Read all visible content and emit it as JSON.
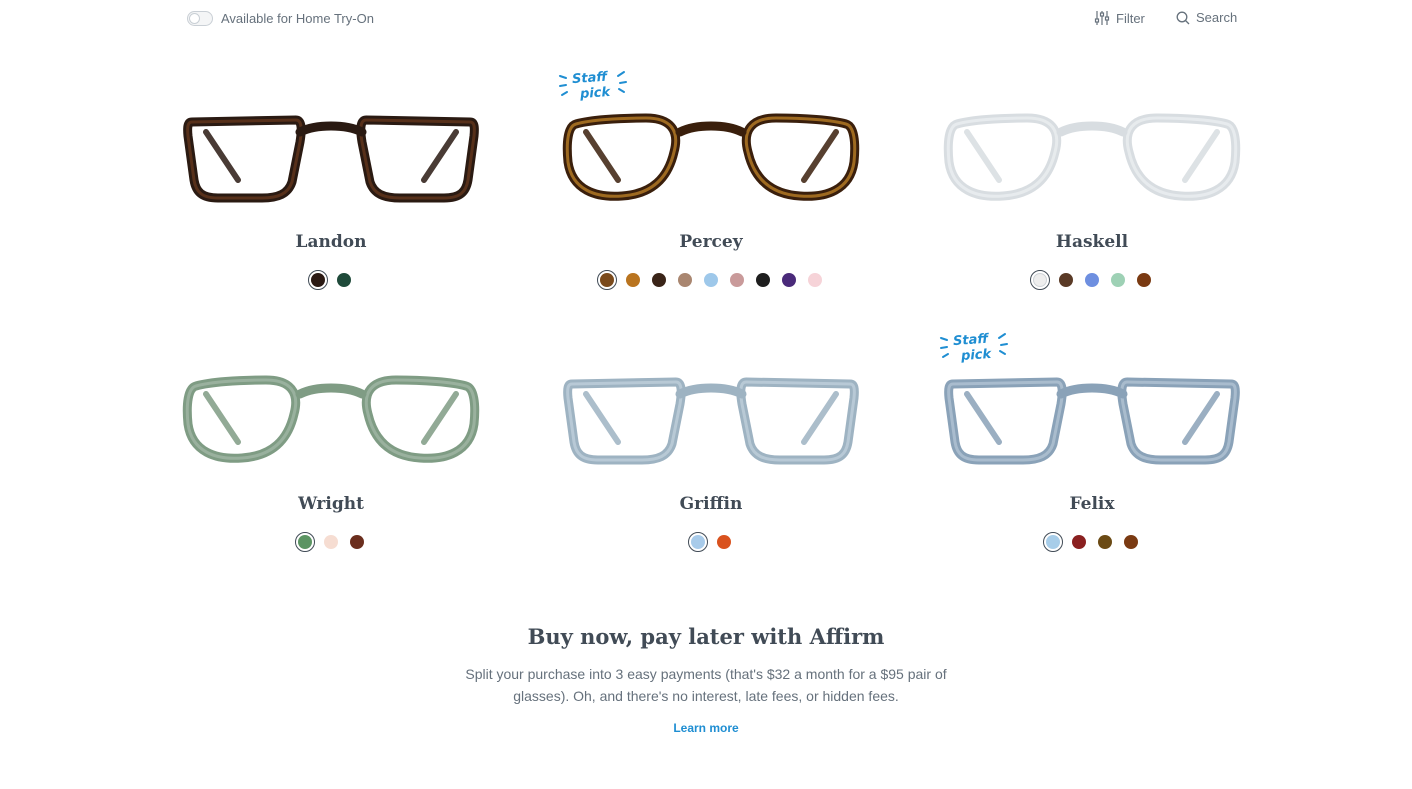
{
  "topbar": {
    "toggle_label": "Available for Home Try-On",
    "filter_label": "Filter",
    "search_label": "Search"
  },
  "badge": {
    "line1": "Staff",
    "line2": "pick",
    "color": "#1f8ed2"
  },
  "frames": [
    {
      "name": "Landon",
      "frame_color": "#2a1a12",
      "accent": "#6b3a1e",
      "style": "square",
      "staff_pick": false,
      "swatches": [
        "#2b1a14",
        "#1f4a3a"
      ],
      "selected": 0
    },
    {
      "name": "Percey",
      "frame_color": "#3a1f0c",
      "accent": "#c98a2a",
      "style": "round",
      "staff_pick": true,
      "swatches": [
        "#7a4a1c",
        "#b9741f",
        "#3a2418",
        "#a98670",
        "#9ec8ea",
        "#c99a9a",
        "#1e1e1e",
        "#4a2a7a",
        "#f6d3d8"
      ],
      "selected": 0
    },
    {
      "name": "Haskell",
      "frame_color": "#d8dde1",
      "accent": "#eef1f3",
      "style": "round",
      "staff_pick": false,
      "swatches": [
        "#eeeeee",
        "#5a3a26",
        "#6e8fe0",
        "#9ed1b5",
        "#7a3a12"
      ],
      "selected": 0
    },
    {
      "name": "Wright",
      "frame_color": "#7f9c84",
      "accent": "#a5bba9",
      "style": "round",
      "staff_pick": false,
      "swatches": [
        "#5b9462",
        "#f6ddd2",
        "#6b2e1e"
      ],
      "selected": 0
    },
    {
      "name": "Griffin",
      "frame_color": "#9eb3c2",
      "accent": "#c3d3de",
      "style": "square",
      "staff_pick": false,
      "swatches": [
        "#a8cbea",
        "#d9521e"
      ],
      "selected": 0
    },
    {
      "name": "Felix",
      "frame_color": "#8aa2b8",
      "accent": "#b7c8d7",
      "style": "square",
      "staff_pick": true,
      "swatches": [
        "#a7cde9",
        "#8a2020",
        "#6b4a14",
        "#7a3a12"
      ],
      "selected": 0
    }
  ],
  "affirm": {
    "title": "Buy now, pay later with Affirm",
    "body": "Split your purchase into 3 easy payments (that's $32 a month for a $95 pair of glasses). Oh, and there's no interest, late fees, or hidden fees.",
    "link": "Learn more"
  }
}
